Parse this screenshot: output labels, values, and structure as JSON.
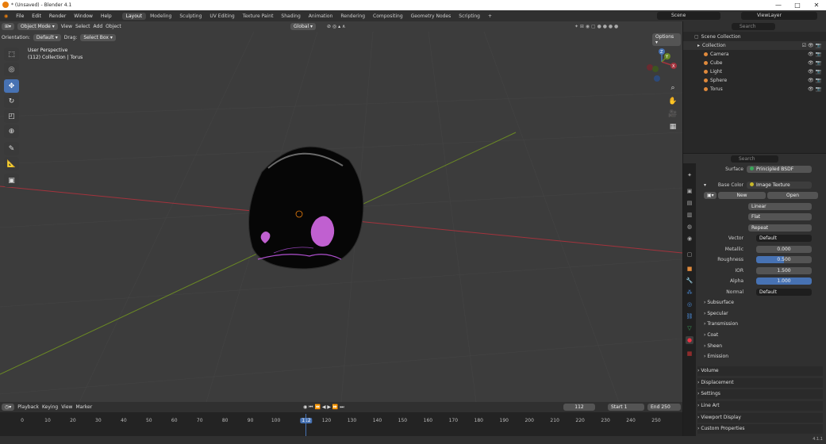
{
  "window": {
    "title": "* (Unsaved) - Blender 4.1",
    "controls": [
      "—",
      "□",
      "✕"
    ]
  },
  "menu": [
    "File",
    "Edit",
    "Render",
    "Window",
    "Help"
  ],
  "workspaces": [
    "Layout",
    "Modeling",
    "Sculpting",
    "UV Editing",
    "Texture Paint",
    "Shading",
    "Animation",
    "Rendering",
    "Compositing",
    "Geometry Nodes",
    "Scripting",
    "+"
  ],
  "scene": {
    "scene": "Scene",
    "view_layer": "ViewLayer"
  },
  "viewport": {
    "mode": "Object Mode",
    "menus": [
      "View",
      "Select",
      "Add",
      "Object"
    ],
    "orientation_label": "Orientation:",
    "orientation": "Default",
    "drag_label": "Drag:",
    "drag": "Select Box",
    "transform": "Global",
    "options": "Options",
    "info_line1": "User Perspective",
    "info_line2": "(112) Collection | Torus",
    "gizmo": {
      "x": "X",
      "y": "Y",
      "z": "Z"
    }
  },
  "outliner": {
    "search_placeholder": "Search",
    "root": "Scene Collection",
    "collection": "Collection",
    "items": [
      {
        "name": "Camera",
        "color": "#e08a3c"
      },
      {
        "name": "Cube",
        "color": "#e08a3c"
      },
      {
        "name": "Light",
        "color": "#e08a3c"
      },
      {
        "name": "Sphere",
        "color": "#e08a3c"
      },
      {
        "name": "Torus",
        "color": "#e08a3c"
      }
    ]
  },
  "properties": {
    "search_placeholder": "Search",
    "surface_label": "Surface",
    "surface": "Principled BSDF",
    "base_color_label": "Base Color",
    "base_color": "Image Texture",
    "new": "New",
    "open": "Open",
    "interp": "Linear",
    "proj": "Flat",
    "ext": "Repeat",
    "rows": [
      {
        "label": "Vector",
        "value": "Default",
        "kind": "dark"
      },
      {
        "label": "Metallic",
        "value": "0.000",
        "kind": "num"
      },
      {
        "label": "Roughness",
        "value": "0.500",
        "kind": "blue",
        "fill": 0.5
      },
      {
        "label": "IOR",
        "value": "1.500",
        "kind": "num"
      },
      {
        "label": "Alpha",
        "value": "1.000",
        "kind": "blue",
        "fill": 1.0
      },
      {
        "label": "Normal",
        "value": "Default",
        "kind": "dark"
      }
    ],
    "subsections": [
      "Subsurface",
      "Specular",
      "Transmission",
      "Coat",
      "Sheen",
      "Emission"
    ],
    "sections": [
      "Volume",
      "Displacement",
      "Settings",
      "Line Art",
      "Viewport Display",
      "Custom Properties"
    ]
  },
  "timeline": {
    "menus": [
      "Playback",
      "Keying",
      "View",
      "Marker"
    ],
    "current_frame": "112",
    "start_label": "Start",
    "start": "1",
    "end_label": "End",
    "end": "250",
    "ticks": [
      "0",
      "10",
      "20",
      "30",
      "40",
      "50",
      "60",
      "70",
      "80",
      "90",
      "100",
      "112",
      "120",
      "130",
      "140",
      "150",
      "160",
      "170",
      "180",
      "190",
      "200",
      "210",
      "220",
      "230",
      "240",
      "250"
    ]
  },
  "status": {
    "version": "4.1.1"
  },
  "colors": {
    "x_axis": "#a3333d",
    "y_axis": "#6b8a24",
    "select": "#4772b3",
    "purple": "#b050d0"
  }
}
